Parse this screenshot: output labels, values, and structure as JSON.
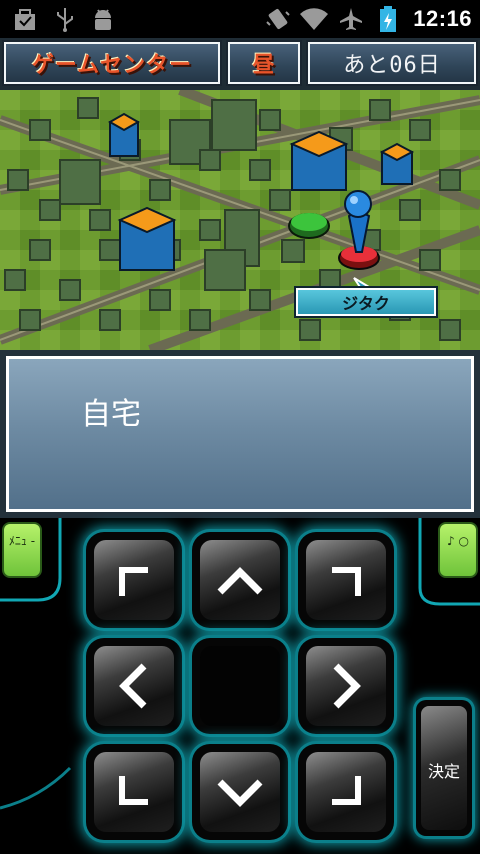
{
  "status_bar": {
    "time": "12:16",
    "left_icons": [
      "bag-icon",
      "usb-icon",
      "android-debug-icon"
    ],
    "right_icons": [
      "vibrate-icon",
      "wifi-icon",
      "airplane-icon",
      "battery-charging-icon"
    ]
  },
  "hud": {
    "location": "ゲームセンター",
    "time_of_day": "昼",
    "days_left": "あと06日"
  },
  "map": {
    "player_location_label": "ジタク"
  },
  "dialog": {
    "text": "自宅"
  },
  "controller": {
    "menu_label": "ﾒﾆｭ -",
    "sound_label": "♪ ○",
    "decide_label": "決定"
  },
  "colors": {
    "accent_glow": "#11a7b4",
    "side_button": "#8fd94c",
    "map_grass": "#6a9a2e",
    "hud_text": "#e8542a"
  }
}
